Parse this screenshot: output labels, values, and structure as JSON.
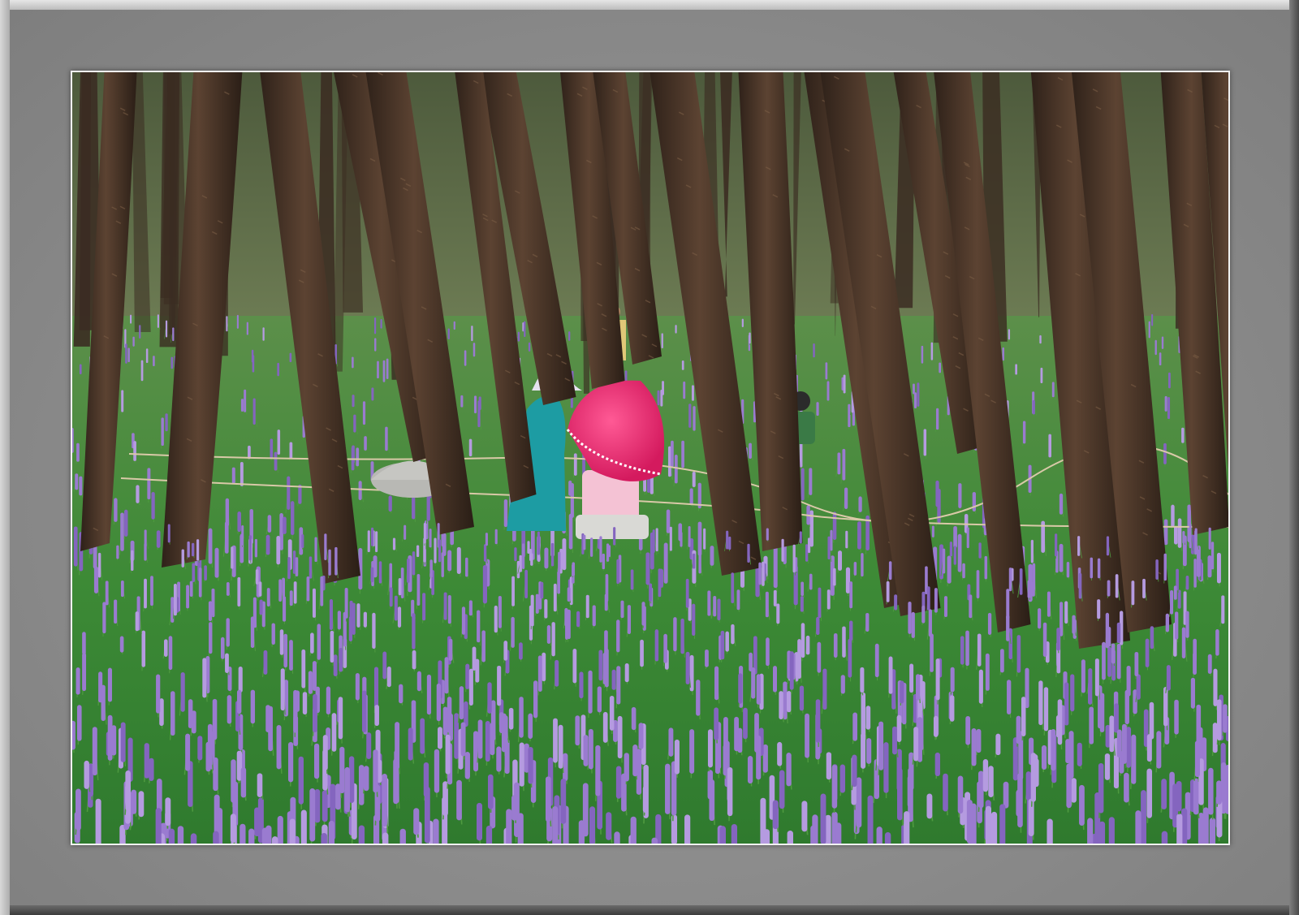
{
  "image": {
    "scene": "pine-grove-lavender-field",
    "colors": {
      "frame_light": "#bdbdbd",
      "frame_dark": "#7a7a7a",
      "mat": "#8a8a8a",
      "inner_border": "#f2f2f2",
      "forest_background": "#5f6e4a",
      "grass": "#3f8f3a",
      "lavender": "#9b7ccf",
      "trunk": "#4a3526",
      "umbrella": "#e0246e",
      "dress": "#1c9aa0"
    }
  }
}
